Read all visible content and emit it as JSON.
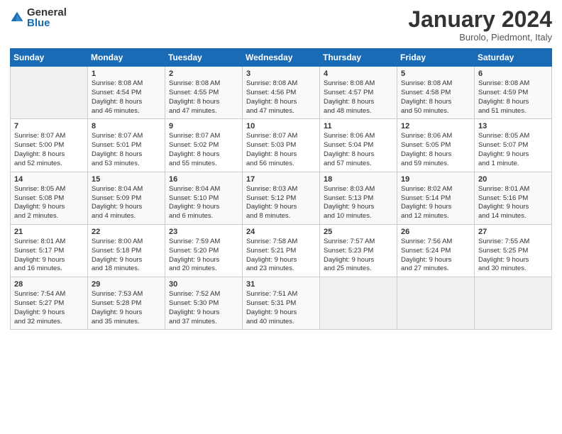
{
  "header": {
    "logo_general": "General",
    "logo_blue": "Blue",
    "month_title": "January 2024",
    "location": "Burolo, Piedmont, Italy"
  },
  "weekdays": [
    "Sunday",
    "Monday",
    "Tuesday",
    "Wednesday",
    "Thursday",
    "Friday",
    "Saturday"
  ],
  "weeks": [
    [
      {
        "day": "",
        "info": ""
      },
      {
        "day": "1",
        "info": "Sunrise: 8:08 AM\nSunset: 4:54 PM\nDaylight: 8 hours\nand 46 minutes."
      },
      {
        "day": "2",
        "info": "Sunrise: 8:08 AM\nSunset: 4:55 PM\nDaylight: 8 hours\nand 47 minutes."
      },
      {
        "day": "3",
        "info": "Sunrise: 8:08 AM\nSunset: 4:56 PM\nDaylight: 8 hours\nand 47 minutes."
      },
      {
        "day": "4",
        "info": "Sunrise: 8:08 AM\nSunset: 4:57 PM\nDaylight: 8 hours\nand 48 minutes."
      },
      {
        "day": "5",
        "info": "Sunrise: 8:08 AM\nSunset: 4:58 PM\nDaylight: 8 hours\nand 50 minutes."
      },
      {
        "day": "6",
        "info": "Sunrise: 8:08 AM\nSunset: 4:59 PM\nDaylight: 8 hours\nand 51 minutes."
      }
    ],
    [
      {
        "day": "7",
        "info": "Sunrise: 8:07 AM\nSunset: 5:00 PM\nDaylight: 8 hours\nand 52 minutes."
      },
      {
        "day": "8",
        "info": "Sunrise: 8:07 AM\nSunset: 5:01 PM\nDaylight: 8 hours\nand 53 minutes."
      },
      {
        "day": "9",
        "info": "Sunrise: 8:07 AM\nSunset: 5:02 PM\nDaylight: 8 hours\nand 55 minutes."
      },
      {
        "day": "10",
        "info": "Sunrise: 8:07 AM\nSunset: 5:03 PM\nDaylight: 8 hours\nand 56 minutes."
      },
      {
        "day": "11",
        "info": "Sunrise: 8:06 AM\nSunset: 5:04 PM\nDaylight: 8 hours\nand 57 minutes."
      },
      {
        "day": "12",
        "info": "Sunrise: 8:06 AM\nSunset: 5:05 PM\nDaylight: 8 hours\nand 59 minutes."
      },
      {
        "day": "13",
        "info": "Sunrise: 8:05 AM\nSunset: 5:07 PM\nDaylight: 9 hours\nand 1 minute."
      }
    ],
    [
      {
        "day": "14",
        "info": "Sunrise: 8:05 AM\nSunset: 5:08 PM\nDaylight: 9 hours\nand 2 minutes."
      },
      {
        "day": "15",
        "info": "Sunrise: 8:04 AM\nSunset: 5:09 PM\nDaylight: 9 hours\nand 4 minutes."
      },
      {
        "day": "16",
        "info": "Sunrise: 8:04 AM\nSunset: 5:10 PM\nDaylight: 9 hours\nand 6 minutes."
      },
      {
        "day": "17",
        "info": "Sunrise: 8:03 AM\nSunset: 5:12 PM\nDaylight: 9 hours\nand 8 minutes."
      },
      {
        "day": "18",
        "info": "Sunrise: 8:03 AM\nSunset: 5:13 PM\nDaylight: 9 hours\nand 10 minutes."
      },
      {
        "day": "19",
        "info": "Sunrise: 8:02 AM\nSunset: 5:14 PM\nDaylight: 9 hours\nand 12 minutes."
      },
      {
        "day": "20",
        "info": "Sunrise: 8:01 AM\nSunset: 5:16 PM\nDaylight: 9 hours\nand 14 minutes."
      }
    ],
    [
      {
        "day": "21",
        "info": "Sunrise: 8:01 AM\nSunset: 5:17 PM\nDaylight: 9 hours\nand 16 minutes."
      },
      {
        "day": "22",
        "info": "Sunrise: 8:00 AM\nSunset: 5:18 PM\nDaylight: 9 hours\nand 18 minutes."
      },
      {
        "day": "23",
        "info": "Sunrise: 7:59 AM\nSunset: 5:20 PM\nDaylight: 9 hours\nand 20 minutes."
      },
      {
        "day": "24",
        "info": "Sunrise: 7:58 AM\nSunset: 5:21 PM\nDaylight: 9 hours\nand 23 minutes."
      },
      {
        "day": "25",
        "info": "Sunrise: 7:57 AM\nSunset: 5:23 PM\nDaylight: 9 hours\nand 25 minutes."
      },
      {
        "day": "26",
        "info": "Sunrise: 7:56 AM\nSunset: 5:24 PM\nDaylight: 9 hours\nand 27 minutes."
      },
      {
        "day": "27",
        "info": "Sunrise: 7:55 AM\nSunset: 5:25 PM\nDaylight: 9 hours\nand 30 minutes."
      }
    ],
    [
      {
        "day": "28",
        "info": "Sunrise: 7:54 AM\nSunset: 5:27 PM\nDaylight: 9 hours\nand 32 minutes."
      },
      {
        "day": "29",
        "info": "Sunrise: 7:53 AM\nSunset: 5:28 PM\nDaylight: 9 hours\nand 35 minutes."
      },
      {
        "day": "30",
        "info": "Sunrise: 7:52 AM\nSunset: 5:30 PM\nDaylight: 9 hours\nand 37 minutes."
      },
      {
        "day": "31",
        "info": "Sunrise: 7:51 AM\nSunset: 5:31 PM\nDaylight: 9 hours\nand 40 minutes."
      },
      {
        "day": "",
        "info": ""
      },
      {
        "day": "",
        "info": ""
      },
      {
        "day": "",
        "info": ""
      }
    ]
  ]
}
